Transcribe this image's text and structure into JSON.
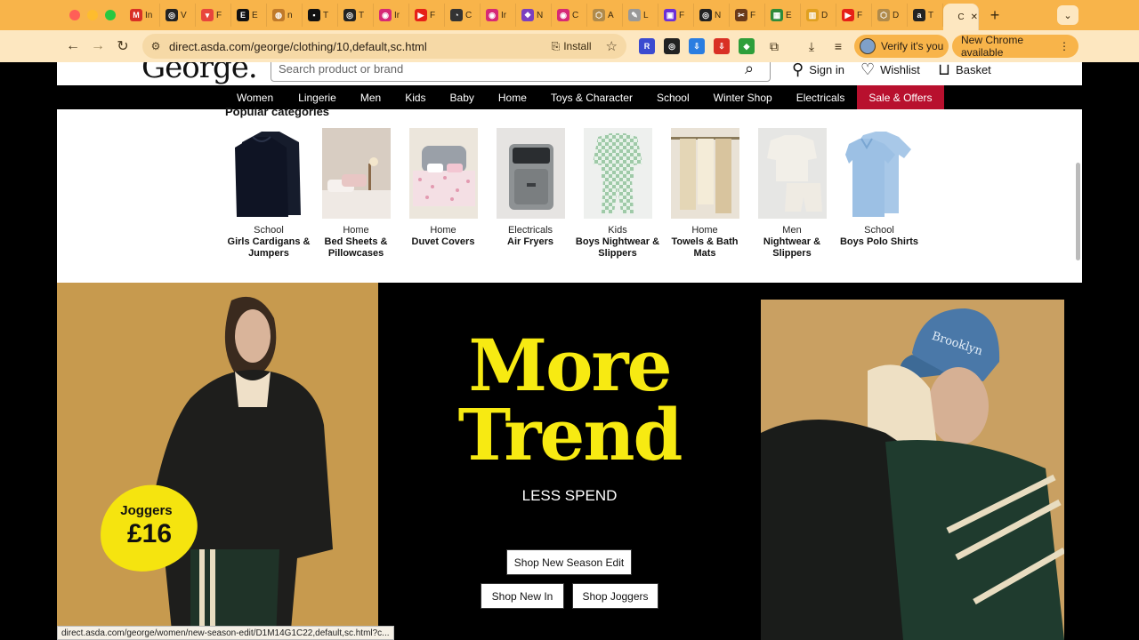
{
  "browser": {
    "tabs": [
      {
        "fav": "M",
        "color": "#d93025",
        "label": "In"
      },
      {
        "fav": "◎",
        "color": "#222",
        "label": "V"
      },
      {
        "fav": "▾",
        "color": "#e8453c",
        "label": "F"
      },
      {
        "fav": "E",
        "color": "#111",
        "label": "E"
      },
      {
        "fav": "◍",
        "color": "#c07a2a",
        "label": "n"
      },
      {
        "fav": "▪",
        "color": "#111",
        "label": "T"
      },
      {
        "fav": "◎",
        "color": "#222",
        "label": "T"
      },
      {
        "fav": "◉",
        "color": "#d62976",
        "label": "Ir"
      },
      {
        "fav": "▶",
        "color": "#e62117",
        "label": "F"
      },
      {
        "fav": "◔",
        "color": "#333",
        "label": "C"
      },
      {
        "fav": "◉",
        "color": "#d62976",
        "label": "Ir"
      },
      {
        "fav": "❖",
        "color": "#7b3fbf",
        "label": "N"
      },
      {
        "fav": "◉",
        "color": "#d62976",
        "label": "C"
      },
      {
        "fav": "⬡",
        "color": "#b08a4a",
        "label": "A"
      },
      {
        "fav": "✎",
        "color": "#999",
        "label": "L"
      },
      {
        "fav": "▣",
        "color": "#6b2fd6",
        "label": "F"
      },
      {
        "fav": "◎",
        "color": "#222",
        "label": "N"
      },
      {
        "fav": "✂",
        "color": "#6a3a1a",
        "label": "F"
      },
      {
        "fav": "▦",
        "color": "#2e8b3a",
        "label": "E"
      },
      {
        "fav": "▥",
        "color": "#e0a020",
        "label": "D"
      },
      {
        "fav": "▶",
        "color": "#e62117",
        "label": "F"
      },
      {
        "fav": "⬡",
        "color": "#b08a4a",
        "label": "D"
      },
      {
        "fav": "a",
        "color": "#222",
        "label": "T"
      },
      {
        "fav": "",
        "color": "#fde7c0",
        "label": "C"
      }
    ],
    "url": "direct.asda.com/george/clothing/10,default,sc.html",
    "install_label": "Install",
    "verify_label": "Verify it's you",
    "new_chrome_label": "New Chrome available",
    "status_url": "direct.asda.com/george/women/new-season-edit/D1M14G1C22,default,sc.html?c..."
  },
  "header": {
    "logo": "George.",
    "search_placeholder": "Search product or brand",
    "signin": "Sign in",
    "wishlist": "Wishlist",
    "basket": "Basket"
  },
  "nav": [
    "Women",
    "Lingerie",
    "Men",
    "Kids",
    "Baby",
    "Home",
    "Toys & Character",
    "School",
    "Winter Shop",
    "Electricals"
  ],
  "nav_sale": "Sale & Offers",
  "popular": {
    "title": "Popular categories",
    "items": [
      {
        "dept": "School",
        "name": "Girls Cardigans & Jumpers"
      },
      {
        "dept": "Home",
        "name": "Bed Sheets & Pillowcases"
      },
      {
        "dept": "Home",
        "name": "Duvet Covers"
      },
      {
        "dept": "Electricals",
        "name": "Air Fryers"
      },
      {
        "dept": "Kids",
        "name": "Boys Nightwear & Slippers"
      },
      {
        "dept": "Home",
        "name": "Towels & Bath Mats"
      },
      {
        "dept": "Men",
        "name": "Nightwear & Slippers"
      },
      {
        "dept": "School",
        "name": "Boys Polo Shirts"
      }
    ]
  },
  "hero": {
    "badge_line1": "Joggers",
    "badge_line2": "£16",
    "headline_line1": "More",
    "headline_line2": "Trend",
    "subline": "LESS SPEND",
    "cta_new_season": "Shop New Season Edit",
    "cta_new_in": "Shop New In",
    "cta_joggers": "Shop Joggers",
    "cap_text": "Brooklyn"
  }
}
